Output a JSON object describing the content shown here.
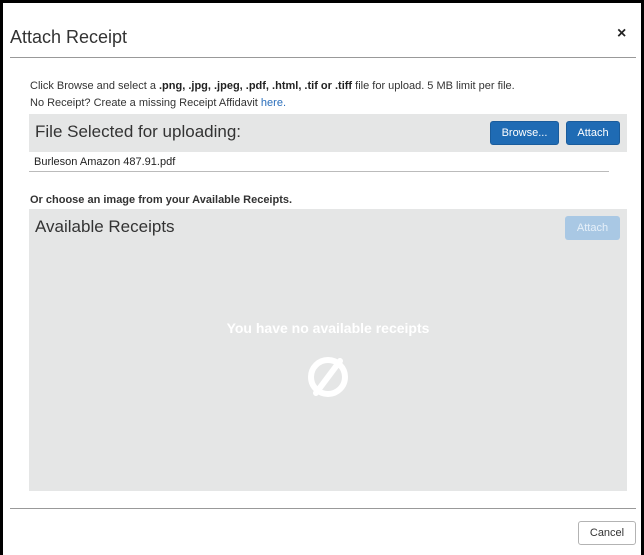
{
  "dialog": {
    "title": "Attach Receipt",
    "close_glyph": "×"
  },
  "instructions": {
    "prefix": "Click Browse and select a ",
    "formats": ".png, .jpg, .jpeg, .pdf, .html, .tif or .tiff",
    "suffix": " file for upload. 5 MB limit per file.",
    "missing_text": "No Receipt? Create a missing Receipt Affidavit ",
    "missing_link": "here."
  },
  "upload": {
    "header_label": "File Selected for uploading:",
    "browse_label": "Browse...",
    "attach_label": "Attach",
    "selected_file": "Burleson Amazon 487.91.pdf"
  },
  "available": {
    "intro": "Or choose an image from your Available Receipts.",
    "header_label": "Available Receipts",
    "attach_label": "Attach",
    "empty_message": "You have no available receipts",
    "empty_icon": "no-symbol-icon"
  },
  "footer": {
    "cancel_label": "Cancel"
  },
  "colors": {
    "primary_button": "#1f6bb4",
    "disabled_button": "#a9c8e4",
    "panel_bg": "#e5e6e6",
    "link": "#2a6ebb"
  }
}
